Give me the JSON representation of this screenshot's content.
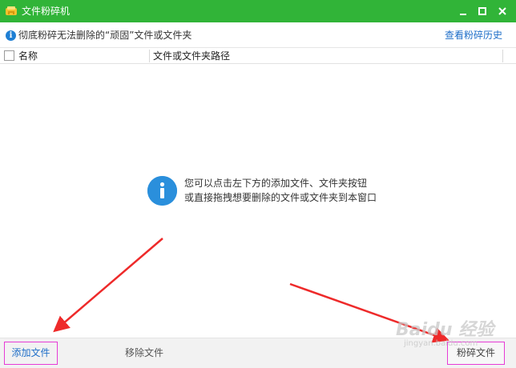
{
  "window": {
    "title": "文件粉碎机",
    "icon": "shredder-app-icon",
    "controls": [
      "minimize",
      "maximize",
      "close"
    ],
    "accent_color": "#31b438"
  },
  "infobar": {
    "message": "彻底粉碎无法删除的“顽固”文件或文件夹",
    "history_link": "查看粉碎历史"
  },
  "table": {
    "columns": [
      "名称",
      "文件或文件夹路径"
    ],
    "rows": []
  },
  "empty_state": {
    "line1": "您可以点击左下方的添加文件、文件夹按钮",
    "line2": "或直接拖拽想要删除的文件或文件夹到本窗口"
  },
  "bottom_bar": {
    "add_label": "添加文件",
    "remove_label": "移除文件",
    "shred_label": "粉碎文件"
  },
  "watermark": {
    "main": "Baidu 经验",
    "sub": "jingyan.baidu.com"
  }
}
